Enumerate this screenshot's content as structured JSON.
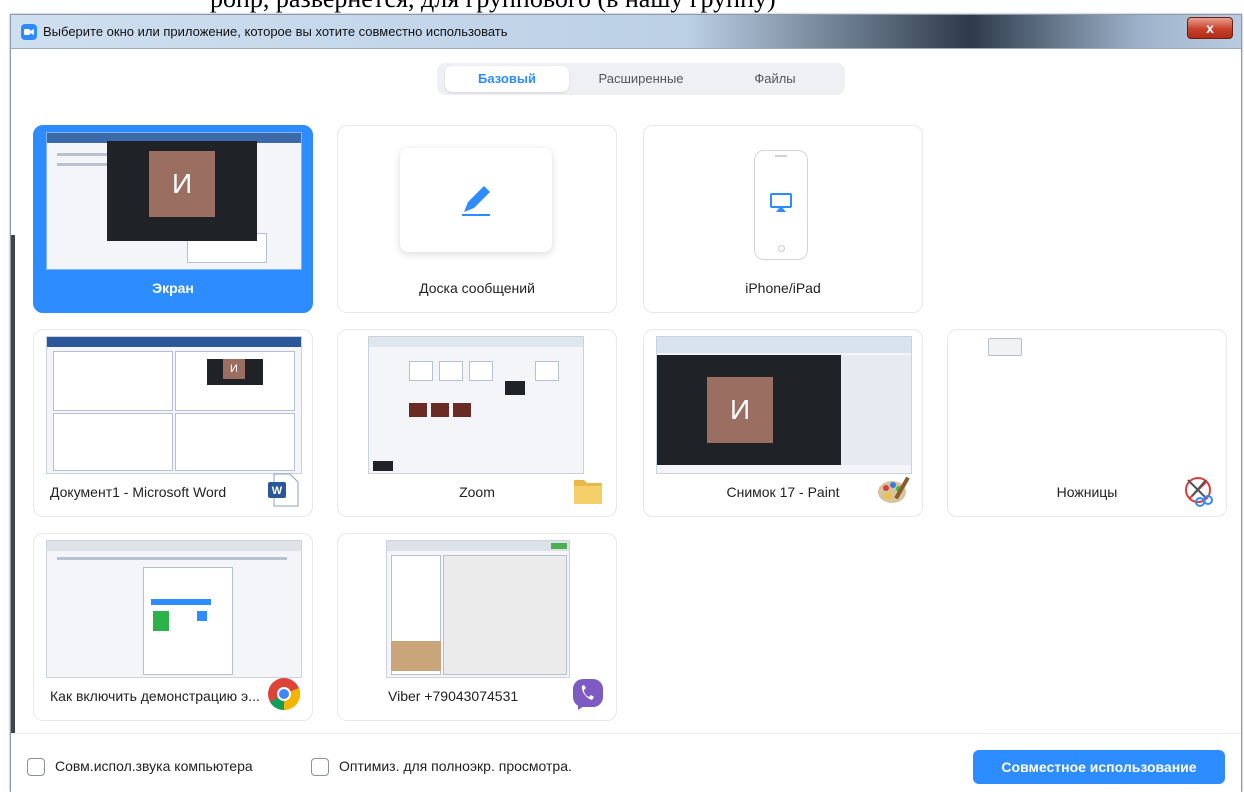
{
  "top_text": "ропр, развернется, для группового (в нашу группу)",
  "window": {
    "title": "Выберите окно или приложение, которое вы хотите совместно использовать",
    "close_label": "x"
  },
  "tabs": [
    {
      "label": "Базовый",
      "active": true
    },
    {
      "label": "Расширенные",
      "active": false
    },
    {
      "label": "Файлы",
      "active": false
    }
  ],
  "cards": {
    "screen": {
      "label": "Экран",
      "avatar_letter": "И",
      "selected": true
    },
    "whiteboard": {
      "label": "Доска сообщений",
      "icon": "pencil-icon"
    },
    "iphone": {
      "label": "iPhone/iPad",
      "icon": "airplay-icon"
    },
    "word": {
      "label": "Документ1 - Microsoft Word",
      "avatar_letter": "И",
      "icon": "word-icon"
    },
    "zoom": {
      "label": "Zoom",
      "icon": "folder-icon"
    },
    "paint": {
      "label": "Снимок 17 - Paint",
      "avatar_letter": "И",
      "icon": "paint-palette-icon"
    },
    "scissors": {
      "label": "Ножницы",
      "icon": "scissors-icon"
    },
    "chrome": {
      "label": "Как включить демонстрацию э...",
      "icon": "chrome-icon"
    },
    "viber": {
      "label": "Viber +79043074531",
      "icon": "viber-icon"
    }
  },
  "bottom": {
    "share_audio_label": "Совм.испол.звука компьютера",
    "optimize_label": "Оптимиз. для полноэкр. просмотра.",
    "share_button": "Совместное использование"
  },
  "colors": {
    "accent": "#2d8cff",
    "avatar": "#9a6f62"
  }
}
